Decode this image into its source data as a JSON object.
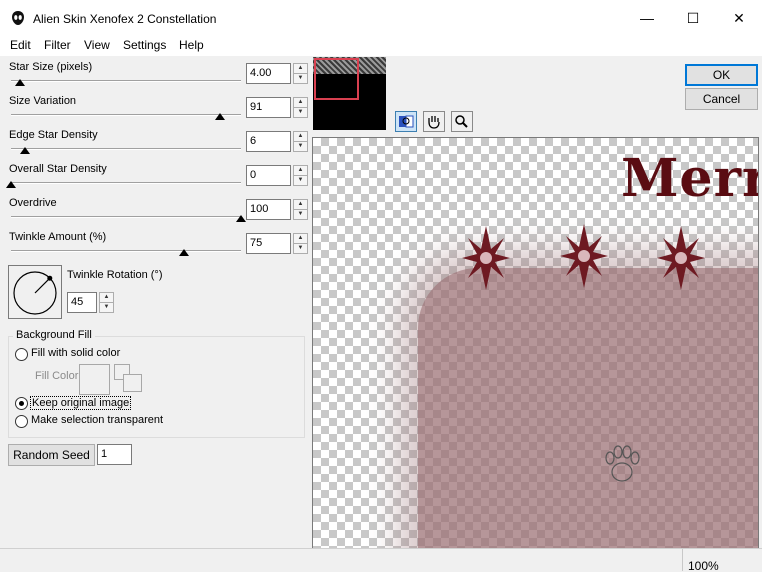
{
  "window": {
    "title": "Alien Skin Xenofex 2 Constellation",
    "minimize": "—",
    "maximize": "☐",
    "close": "✕"
  },
  "menu": [
    "Edit",
    "Filter",
    "View",
    "Settings",
    "Help"
  ],
  "sliders": [
    {
      "label": "Star Size (pixels)",
      "value": "4.00",
      "level": 0.04
    },
    {
      "label": "Size Variation",
      "value": "91",
      "level": 0.91
    },
    {
      "label": "Edge Star Density",
      "value": "6",
      "level": 0.06
    },
    {
      "label": "Overall Star Density",
      "value": "0",
      "level": 0.0
    },
    {
      "label": "Overdrive",
      "value": "100",
      "level": 1.0
    },
    {
      "label": "Twinkle Amount (%)",
      "value": "75",
      "level": 0.75
    }
  ],
  "twinkle_rotation": {
    "label": "Twinkle Rotation (°)",
    "value": "45",
    "angle_deg": 45
  },
  "background_fill": {
    "group_label": "Background Fill",
    "options": [
      "Fill with solid color",
      "Keep original image",
      "Make selection transparent"
    ],
    "selected_index": 1,
    "fill_color_label": "Fill Color"
  },
  "random_seed": {
    "button_label": "Random Seed",
    "value": "1"
  },
  "buttons": {
    "ok": "OK",
    "cancel": "Cancel"
  },
  "preview": {
    "text": "Merry",
    "text_color": "#5a0c12",
    "overlay_color": "#9b6f73"
  },
  "status": {
    "zoom": "100%"
  }
}
